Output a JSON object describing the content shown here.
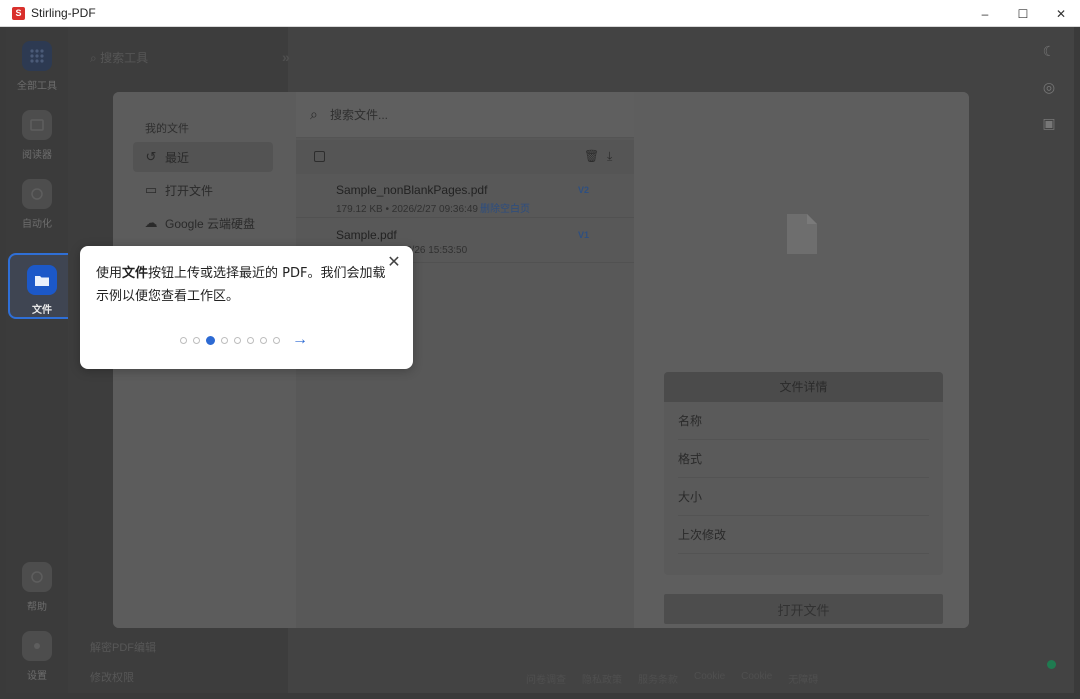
{
  "window": {
    "title": "Stirling-PDF",
    "logo_letter": "S",
    "minimize": "–",
    "maximize": "☐",
    "close": "✕"
  },
  "rail": {
    "items": [
      {
        "label": "全部工具"
      },
      {
        "label": "阅读器"
      },
      {
        "label": "自动化"
      },
      {
        "label": "文件"
      },
      {
        "label": "帮助"
      },
      {
        "label": "设置"
      }
    ]
  },
  "tools": {
    "search_placeholder": "搜索工具",
    "collapse": "»",
    "rows": [
      "解密PDF编辑",
      "修改权限"
    ]
  },
  "bottom_links": [
    "问卷调查",
    "隐私政策",
    "服务条款",
    "Cookie",
    "Cookie",
    "无障碍"
  ],
  "file_manager": {
    "section_title": "我的文件",
    "nav": [
      {
        "label": "最近",
        "icon": "↺"
      },
      {
        "label": "打开文件",
        "icon": "▭"
      },
      {
        "label": "Google 云端硬盘",
        "icon": "☁"
      }
    ],
    "search_placeholder": "搜索文件...",
    "files": [
      {
        "name": "Sample_nonBlankPages.pdf",
        "meta": "179.12 KB • 2026/2/27 09:36:49",
        "tag": "删除空白页",
        "version": "V2"
      },
      {
        "name": "Sample.pdf",
        "meta": "2/26 15:53:50",
        "tag": "",
        "version": "V1"
      }
    ],
    "details": {
      "header": "文件详情",
      "fields": [
        "名称",
        "格式",
        "大小",
        "上次修改"
      ]
    },
    "open_button": "打开文件"
  },
  "tour": {
    "text_before": "使用",
    "text_bold": "文件",
    "text_after": "按钮上传或选择最近的 PDF。我们会加载示例以便您查看工作区。",
    "close": "✕",
    "next": "→",
    "total_steps": 8,
    "current_step": 3
  },
  "colors": {
    "accent": "#2d6ad3",
    "brand": "#d9302c"
  }
}
